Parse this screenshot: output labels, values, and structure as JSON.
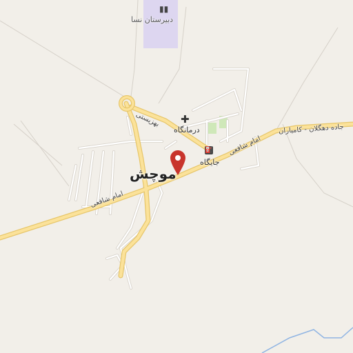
{
  "map": {
    "town_name": "موچش",
    "labels": {
      "school": "دبیرستان نسا",
      "clinic": "درمانگاه",
      "station": "جایگاه",
      "health": "بهزیستی",
      "road_east": "امام شافعی",
      "road_west": "امام شافعی",
      "road_far": "جاده دهگلان - کامیاران"
    },
    "icons": {
      "school": "school-icon",
      "clinic": "medical-cross-icon",
      "fuel": "fuel-station-icon",
      "marker": "location-pin-icon"
    },
    "colors": {
      "background": "#f2efe9",
      "major_road": "#fbe29a",
      "major_road_casing": "#e7c66a",
      "minor_road": "#ffffff",
      "minor_road_casing": "#d9d4cc",
      "school_area": "#ddd6f0",
      "park": "#cfe8b9",
      "water": "#8fb4e3",
      "marker": "#c8342c"
    }
  }
}
